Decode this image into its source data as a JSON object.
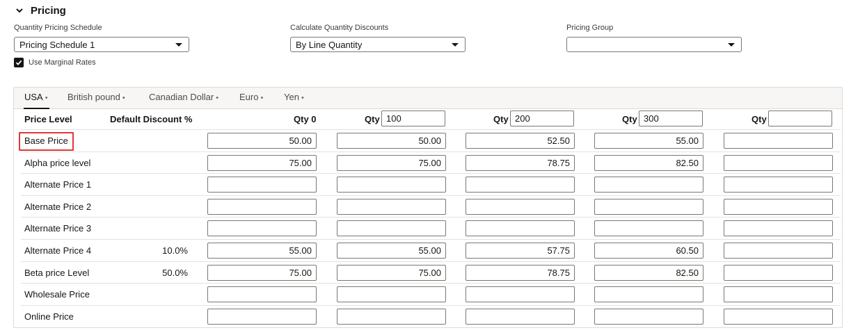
{
  "section": {
    "title": "Pricing",
    "toggle_icon": "chevron-down-icon"
  },
  "fields": {
    "quantity_pricing_schedule": {
      "label": "Quantity Pricing Schedule",
      "value": "Pricing Schedule 1"
    },
    "calculate_quantity_discounts": {
      "label": "Calculate Quantity Discounts",
      "value": "By Line Quantity"
    },
    "pricing_group": {
      "label": "Pricing Group",
      "value": ""
    }
  },
  "use_marginal_rates": {
    "label": "Use Marginal Rates",
    "checked": true
  },
  "tabs": [
    {
      "label": "USA",
      "marker": "•",
      "active": true
    },
    {
      "label": "British pound",
      "marker": "•",
      "active": false
    },
    {
      "label": "Canadian Dollar",
      "marker": "•",
      "active": false
    },
    {
      "label": "Euro",
      "marker": "•",
      "active": false
    },
    {
      "label": "Yen",
      "marker": "•",
      "active": false
    }
  ],
  "table": {
    "headers": {
      "price_level": "Price Level",
      "default_discount": "Default Discount %",
      "qty0": "Qty 0",
      "qty_label": "Qty",
      "qty_values": [
        "100",
        "200",
        "300",
        ""
      ]
    },
    "rows": [
      {
        "label": "Base Price",
        "discount": "",
        "values": [
          "50.00",
          "50.00",
          "52.50",
          "55.00",
          ""
        ]
      },
      {
        "label": "Alpha price level",
        "discount": "",
        "values": [
          "75.00",
          "75.00",
          "78.75",
          "82.50",
          ""
        ]
      },
      {
        "label": "Alternate Price 1",
        "discount": "",
        "values": [
          "",
          "",
          "",
          "",
          ""
        ]
      },
      {
        "label": "Alternate Price 2",
        "discount": "",
        "values": [
          "",
          "",
          "",
          "",
          ""
        ]
      },
      {
        "label": "Alternate Price 3",
        "discount": "",
        "values": [
          "",
          "",
          "",
          "",
          ""
        ]
      },
      {
        "label": "Alternate Price 4",
        "discount": "10.0%",
        "values": [
          "55.00",
          "55.00",
          "57.75",
          "60.50",
          ""
        ]
      },
      {
        "label": "Beta price Level",
        "discount": "50.0%",
        "values": [
          "75.00",
          "75.00",
          "78.75",
          "82.50",
          ""
        ]
      },
      {
        "label": "Wholesale Price",
        "discount": "",
        "values": [
          "",
          "",
          "",
          "",
          ""
        ]
      },
      {
        "label": "Online Price",
        "discount": "",
        "values": [
          "",
          "",
          "",
          "",
          ""
        ]
      }
    ]
  },
  "colors": {
    "highlight": "#e0373a",
    "text": "#161513",
    "border": "#7a7874"
  }
}
